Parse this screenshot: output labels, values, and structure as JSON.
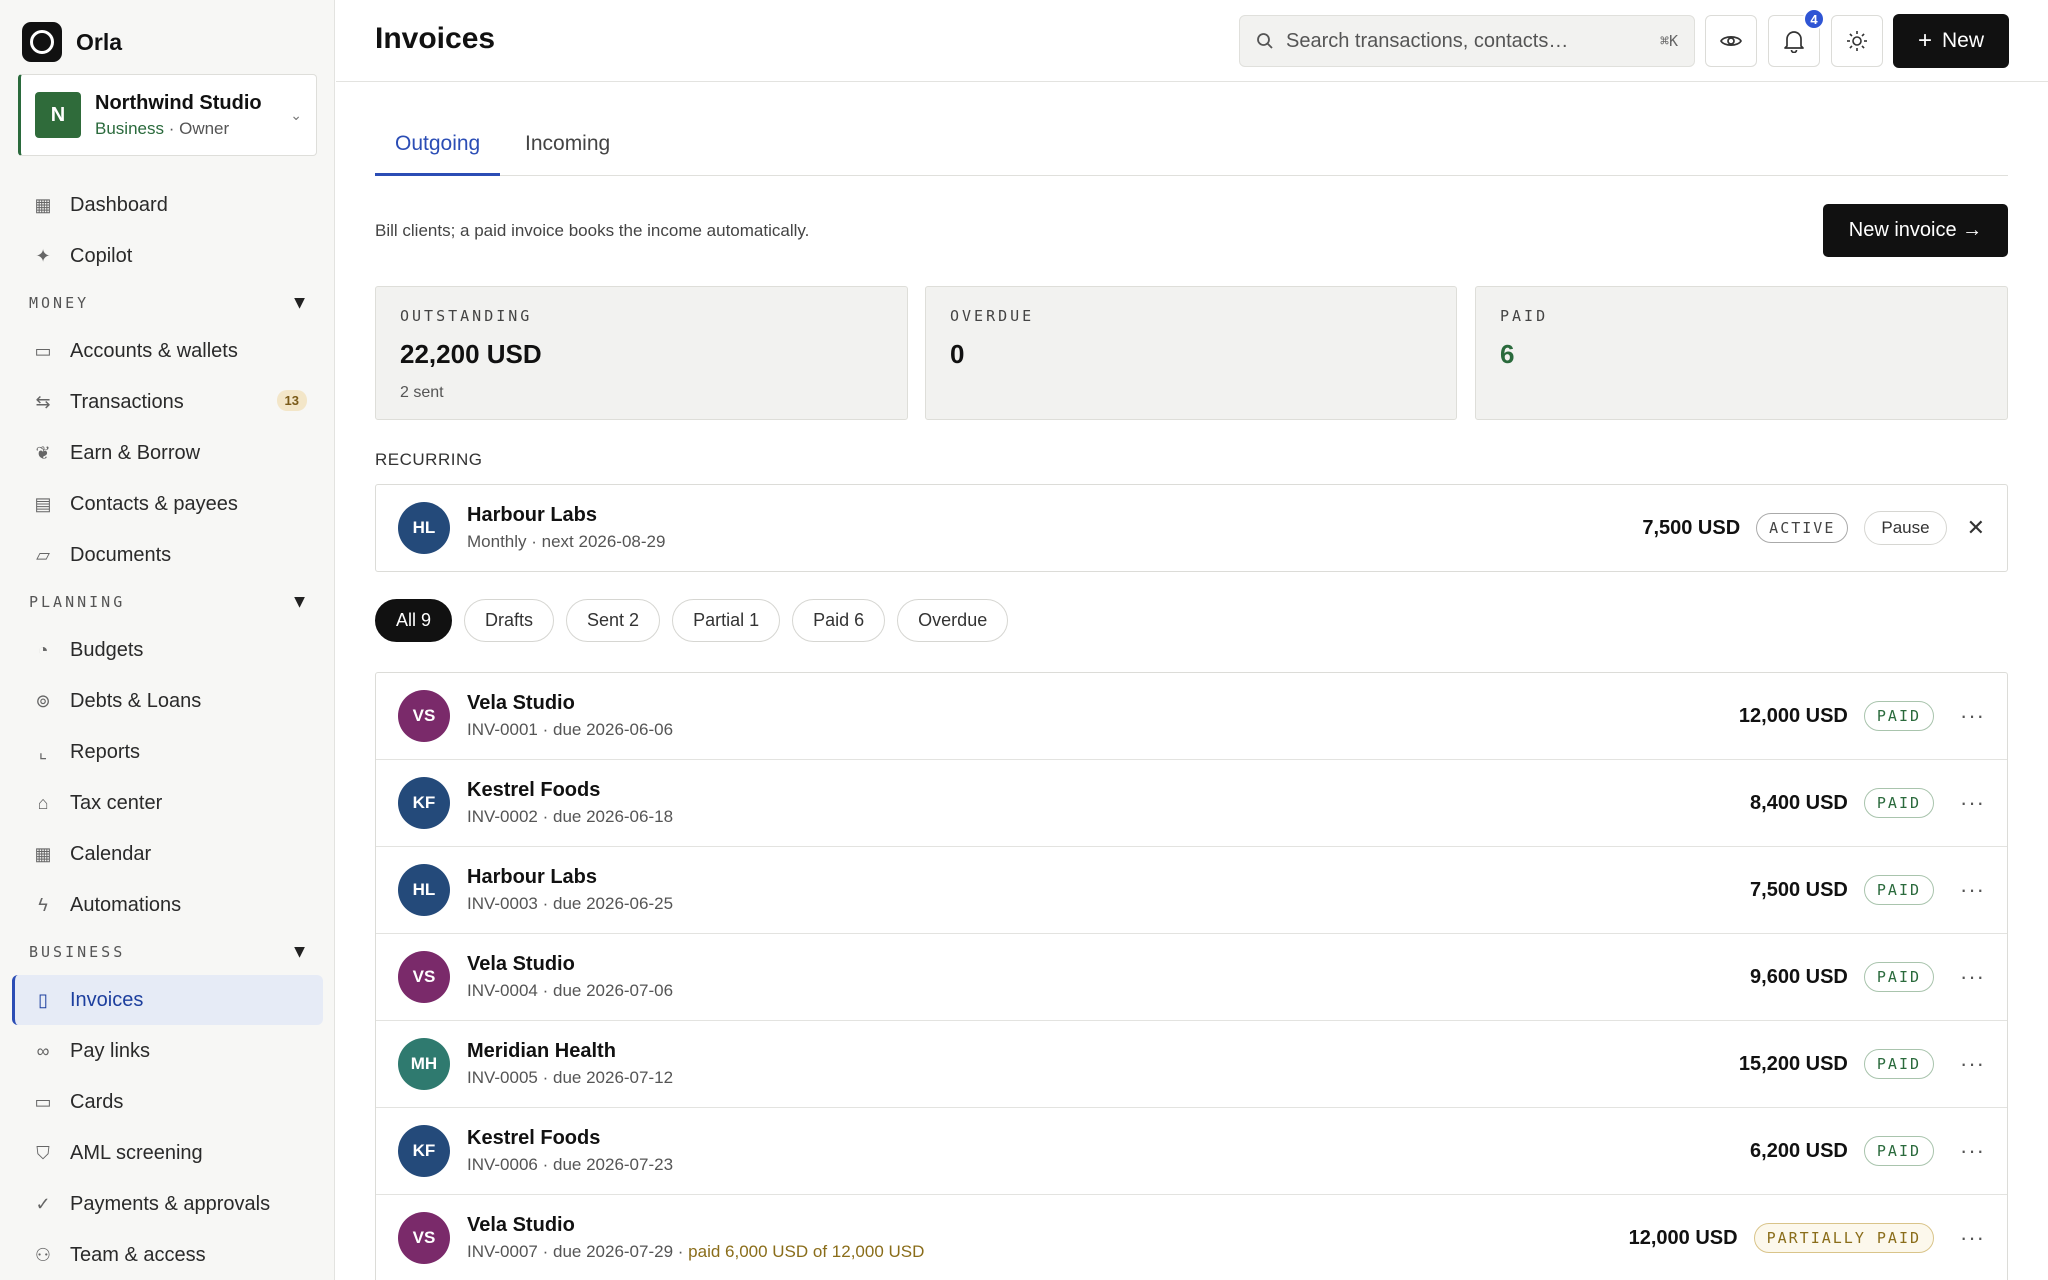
{
  "app": {
    "name": "Orla"
  },
  "org": {
    "name": "Northwind Studio",
    "avatar": "N",
    "plan": "Business",
    "role": "· Owner"
  },
  "sidebar": {
    "top_items": [
      {
        "label": "Dashboard",
        "icon": "grid-icon"
      },
      {
        "label": "Copilot",
        "icon": "sparkle-icon"
      }
    ],
    "sections": [
      {
        "title": "MONEY",
        "items": [
          {
            "label": "Accounts & wallets",
            "icon": "wallet-icon"
          },
          {
            "label": "Transactions",
            "icon": "arrows-icon",
            "badge": "13"
          },
          {
            "label": "Earn & Borrow",
            "icon": "leaf-icon"
          },
          {
            "label": "Contacts & payees",
            "icon": "contact-card-icon"
          },
          {
            "label": "Documents",
            "icon": "folder-icon"
          }
        ]
      },
      {
        "title": "PLANNING",
        "items": [
          {
            "label": "Budgets",
            "icon": "pie-icon"
          },
          {
            "label": "Debts & Loans",
            "icon": "coins-icon"
          },
          {
            "label": "Reports",
            "icon": "line-chart-icon"
          },
          {
            "label": "Tax center",
            "icon": "bank-icon"
          },
          {
            "label": "Calendar",
            "icon": "calendar-icon"
          },
          {
            "label": "Automations",
            "icon": "bolt-icon"
          }
        ]
      },
      {
        "title": "BUSINESS",
        "items": [
          {
            "label": "Invoices",
            "icon": "document-icon",
            "active": true
          },
          {
            "label": "Pay links",
            "icon": "link-icon"
          },
          {
            "label": "Cards",
            "icon": "card-icon"
          },
          {
            "label": "AML screening",
            "icon": "shield-icon"
          },
          {
            "label": "Payments & approvals",
            "icon": "check-circle-icon"
          },
          {
            "label": "Team & access",
            "icon": "users-icon"
          }
        ]
      }
    ]
  },
  "header": {
    "title": "Invoices",
    "search_placeholder": "Search transactions, contacts…",
    "search_shortcut": "⌘K",
    "notifications": "4",
    "new_label": "New"
  },
  "tabs": [
    {
      "label": "Outgoing",
      "active": true
    },
    {
      "label": "Incoming",
      "active": false
    }
  ],
  "intro": "Bill clients; a paid invoice books the income automatically.",
  "new_invoice_label": "New invoice →",
  "stats": [
    {
      "label": "OUTSTANDING",
      "value": "22,200 USD",
      "sub": "2 sent"
    },
    {
      "label": "OVERDUE",
      "value": "0",
      "sub": ""
    },
    {
      "label": "PAID",
      "value": "6",
      "sub": ""
    }
  ],
  "recurring": {
    "label": "RECURRING",
    "initials": "HL",
    "avatar_color": "#244a7a",
    "name": "Harbour Labs",
    "sub": "Monthly · next 2026-08-29",
    "amount": "7,500 USD",
    "status": "ACTIVE",
    "pause_label": "Pause"
  },
  "filters": [
    "All 9",
    "Drafts",
    "Sent 2",
    "Partial 1",
    "Paid 6",
    "Overdue"
  ],
  "invoices": [
    {
      "initials": "VS",
      "color": "#7a2a6a",
      "name": "Vela Studio",
      "sub": "INV-0001 · due 2026-06-06",
      "amount": "12,000 USD",
      "status": "PAID"
    },
    {
      "initials": "KF",
      "color": "#244a7a",
      "name": "Kestrel Foods",
      "sub": "INV-0002 · due 2026-06-18",
      "amount": "8,400 USD",
      "status": "PAID"
    },
    {
      "initials": "HL",
      "color": "#244a7a",
      "name": "Harbour Labs",
      "sub": "INV-0003 · due 2026-06-25",
      "amount": "7,500 USD",
      "status": "PAID"
    },
    {
      "initials": "VS",
      "color": "#7a2a6a",
      "name": "Vela Studio",
      "sub": "INV-0004 · due 2026-07-06",
      "amount": "9,600 USD",
      "status": "PAID"
    },
    {
      "initials": "MH",
      "color": "#2f7a6f",
      "name": "Meridian Health",
      "sub": "INV-0005 · due 2026-07-12",
      "amount": "15,200 USD",
      "status": "PAID"
    },
    {
      "initials": "KF",
      "color": "#244a7a",
      "name": "Kestrel Foods",
      "sub": "INV-0006 · due 2026-07-23",
      "amount": "6,200 USD",
      "status": "PAID"
    },
    {
      "initials": "VS",
      "color": "#7a2a6a",
      "name": "Vela Studio",
      "sub": "INV-0007 · due 2026-07-29 ·",
      "sub_extra": "paid 6,000 USD of 12,000 USD",
      "amount": "12,000 USD",
      "status": "PARTIALLY PAID"
    }
  ]
}
